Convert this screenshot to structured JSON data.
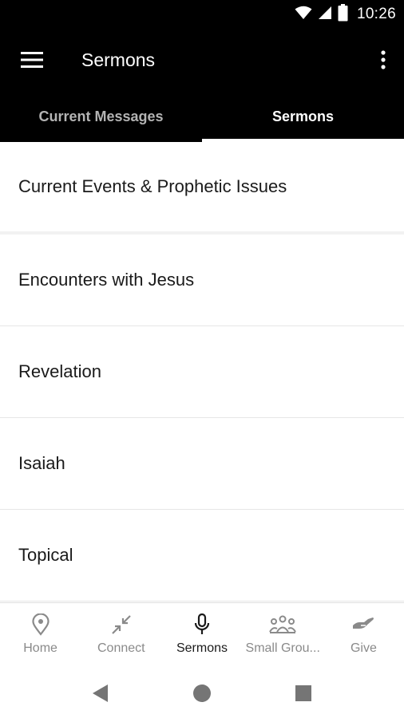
{
  "status_bar": {
    "time": "10:26",
    "icons": [
      "wifi-icon",
      "signal-icon",
      "battery-icon"
    ]
  },
  "app_bar": {
    "title": "Sermons",
    "menu_icon": "hamburger-menu-icon",
    "more_icon": "more-vertical-icon"
  },
  "tabs": [
    {
      "label": "Current Messages",
      "active": false
    },
    {
      "label": "Sermons",
      "active": true
    }
  ],
  "list": [
    {
      "label": "Current Events & Prophetic Issues"
    },
    {
      "label": "Encounters with Jesus"
    },
    {
      "label": "Revelation"
    },
    {
      "label": "Isaiah"
    },
    {
      "label": "Topical"
    }
  ],
  "bottom_nav": [
    {
      "label": "Home",
      "icon": "location-pin-icon",
      "active": false
    },
    {
      "label": "Connect",
      "icon": "arrows-inward-icon",
      "active": false
    },
    {
      "label": "Sermons",
      "icon": "microphone-icon",
      "active": true
    },
    {
      "label": "Small Grou...",
      "icon": "group-icon",
      "active": false
    },
    {
      "label": "Give",
      "icon": "hand-give-icon",
      "active": false
    }
  ],
  "system_nav": {
    "back": "back-triangle-icon",
    "home": "home-circle-icon",
    "recents": "recents-square-icon"
  },
  "colors": {
    "bar_background": "#000000",
    "inactive_tab": "#b3b3b3",
    "nav_inactive": "#8a8a8a",
    "nav_active": "#1a1a1a"
  }
}
